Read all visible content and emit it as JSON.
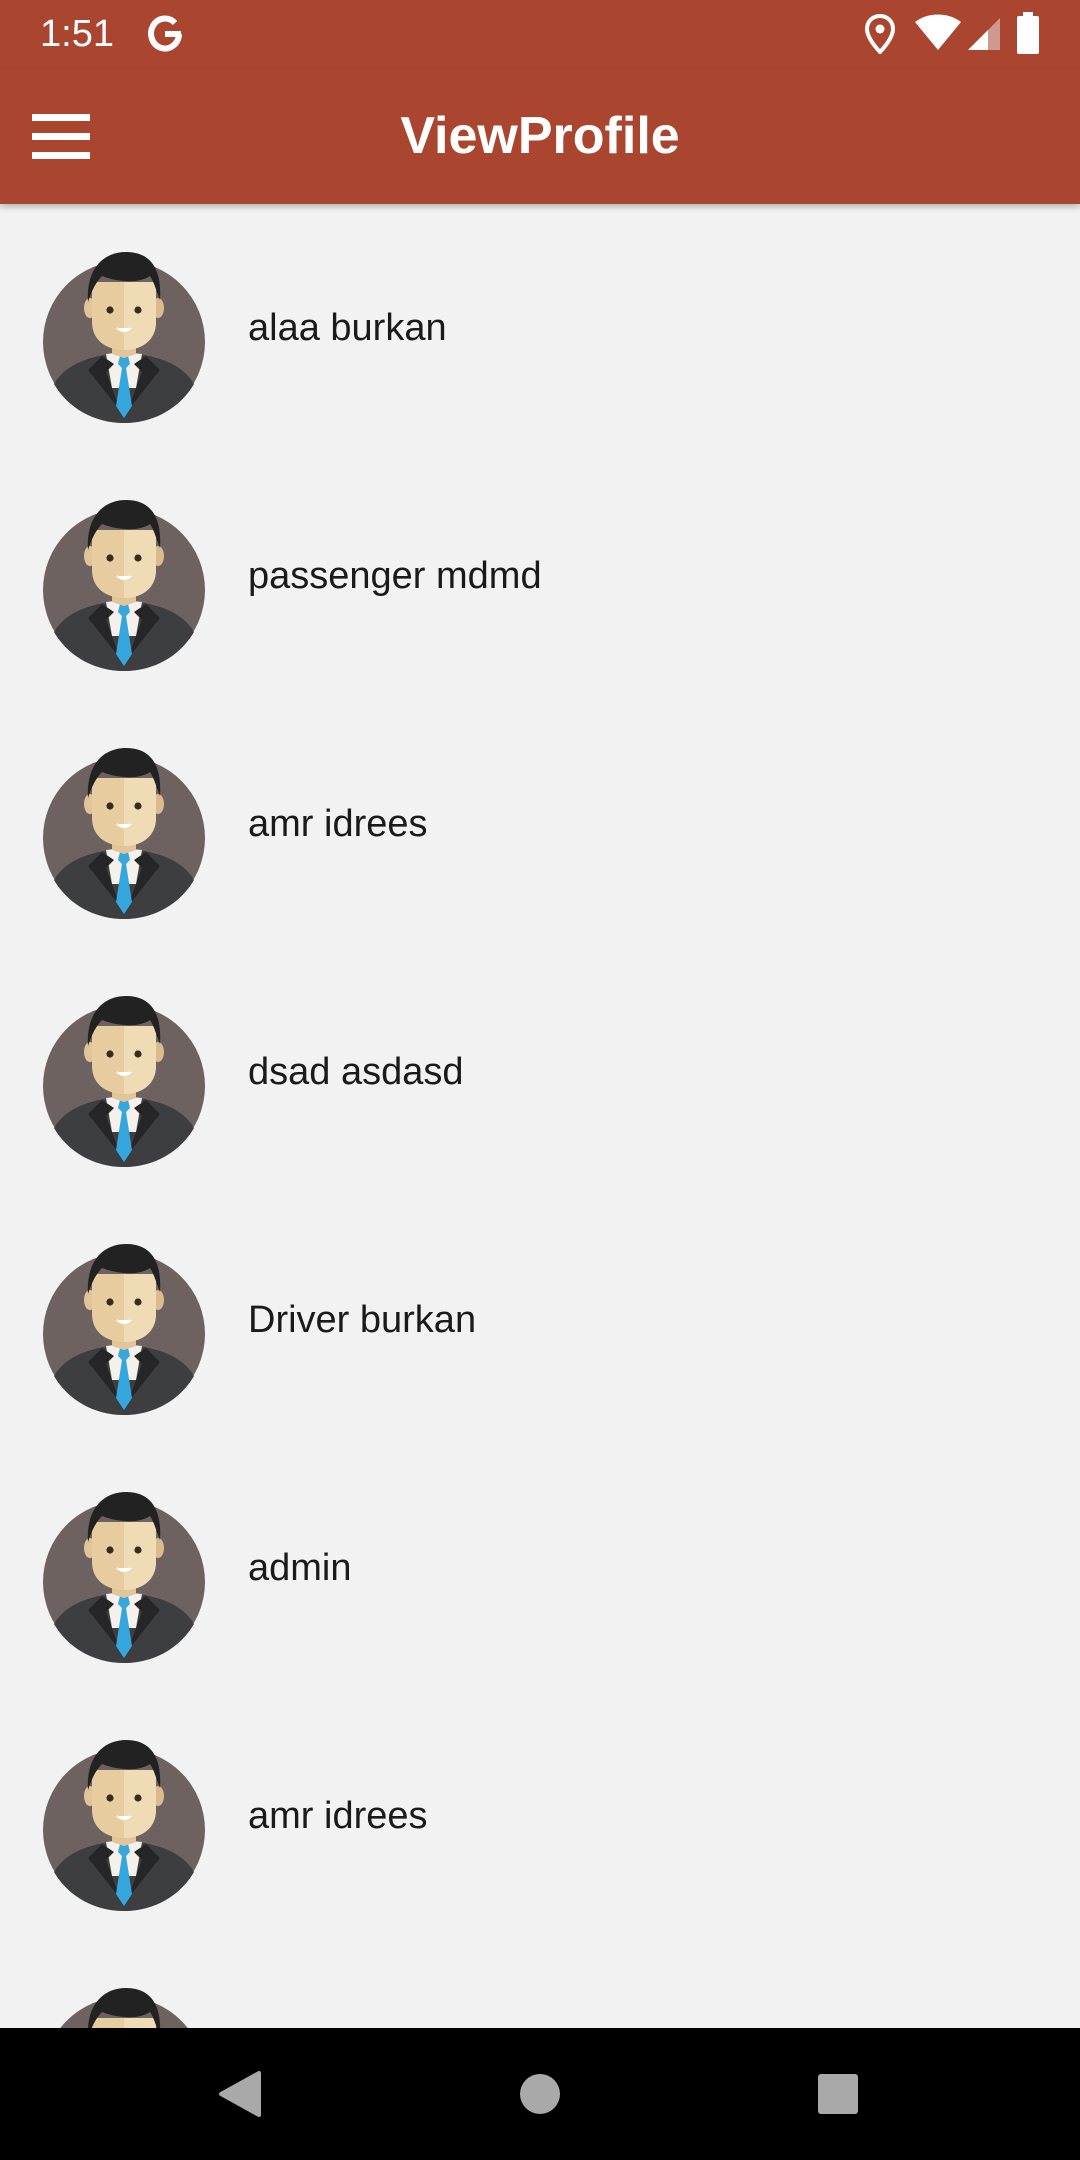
{
  "status_bar": {
    "time": "1:51",
    "left_icon": "google-g-icon",
    "right_icons": [
      "location-icon",
      "wifi-icon",
      "signal-icon",
      "battery-icon"
    ]
  },
  "app_bar": {
    "title": "ViewProfile",
    "menu_icon": "hamburger-menu-icon"
  },
  "colors": {
    "primary": "#aa4630",
    "background": "#f2f2f2",
    "text": "#1a1a1a"
  },
  "profiles": [
    {
      "name": "alaa burkan"
    },
    {
      "name": "passenger mdmd"
    },
    {
      "name": "amr idrees"
    },
    {
      "name": "dsad asdasd"
    },
    {
      "name": "Driver burkan"
    },
    {
      "name": "admin"
    },
    {
      "name": "amr idrees"
    },
    {
      "name": ""
    }
  ],
  "nav_bar": {
    "buttons": [
      "back-icon",
      "home-icon",
      "recents-icon"
    ]
  }
}
